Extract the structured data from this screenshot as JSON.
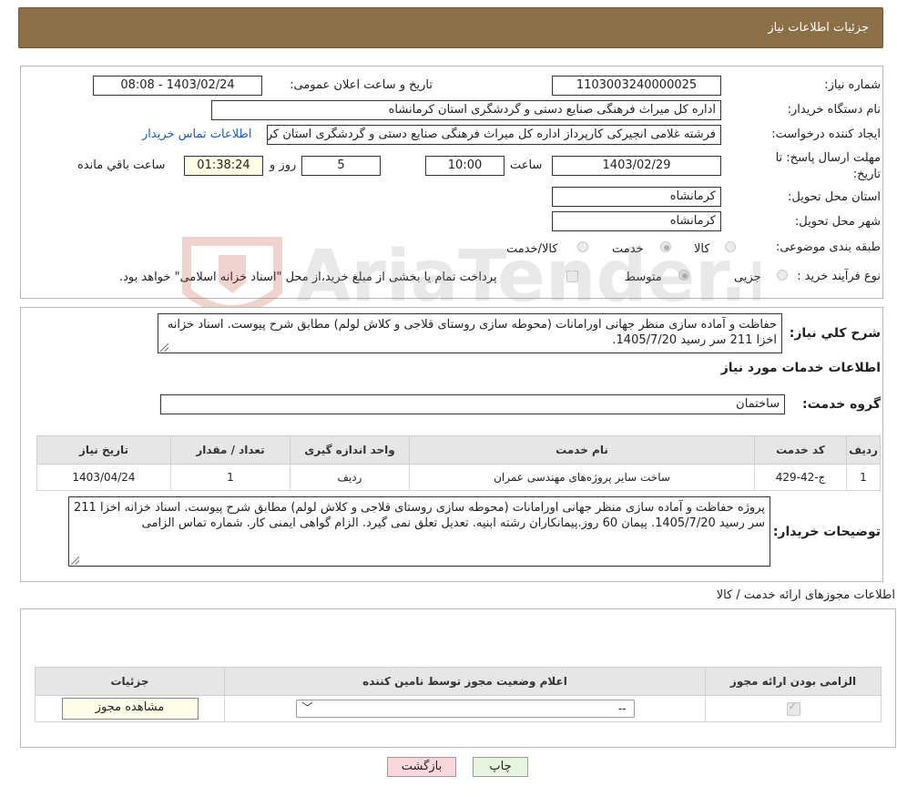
{
  "header": {
    "title": "جزئیات اطلاعات نیاز"
  },
  "form": {
    "need_number": {
      "label": "شماره نیاز:",
      "value": "1103003240000025"
    },
    "announce_datetime": {
      "label": "تاریخ و ساعت اعلان عمومی:",
      "value": "1403/02/24 - 08:08"
    },
    "buyer_org": {
      "label": "نام دستگاه خریدار:",
      "value": "اداره کل میراث فرهنگی  صنایع دستی و گردشگری استان کرمانشاه"
    },
    "requester": {
      "label": "ایجاد کننده درخواست:",
      "value": "فرشته غلامی انجیرکی کارپرداز اداره کل میراث فرهنگی  صنایع دستی و گردشگری استان کرمانشاه",
      "contact_link": "اطلاعات تماس خریدار"
    },
    "deadline": {
      "label_line1": "مهلت ارسال پاسخ: تا",
      "label_line2": "تاریخ:",
      "date": "1403/02/29",
      "time_label": "ساعت",
      "time": "10:00",
      "days": "5",
      "days_label": "روز و",
      "remaining": "01:38:24",
      "remaining_label": "ساعت باقي مانده"
    },
    "delivery_province": {
      "label": "استان محل تحویل:",
      "value": "کرمانشاه"
    },
    "delivery_city": {
      "label": "شهر محل تحویل:",
      "value": "کرمانشاه"
    },
    "category": {
      "label": "طبقه بندی موضوعی:",
      "options": [
        "کالا",
        "خدمت",
        "کالا/خدمت"
      ],
      "selected": "خدمت"
    },
    "purchase_type": {
      "label": "نوع فرآیند خرید :",
      "options": [
        "جزیی",
        "متوسط"
      ],
      "selected": "متوسط",
      "treasury_checkbox_label": "پرداخت تمام یا بخشی از مبلغ خرید،از محل \"اسناد خزانه اسلامی\" خواهد بود."
    }
  },
  "summary": {
    "label": "شرح کلي نياز:",
    "text": "حفاظت و آماده سازی منظر جهانی اورامانات (محوطه سازی روستای قلاجی و کلاش لولم) مطابق شرح پیوست. اسناد خزانه اخزا 211 سر رسید 1405/7/20."
  },
  "services_section": {
    "title": "اطلاعات خدمات مورد نیاز",
    "group_label": "گروه خدمت:",
    "group_value": "ساختمان",
    "table": {
      "headers": [
        "ردیف",
        "کد خدمت",
        "نام خدمت",
        "واحد اندازه گیری",
        "تعداد / مقدار",
        "تاریخ نیاز"
      ],
      "rows": [
        [
          "1",
          "ج-42-429",
          "ساخت سایر پروژه‌های مهندسی عمران",
          "ردیف",
          "1",
          "1403/04/24"
        ]
      ]
    },
    "buyer_notes_label": "توضیحات خریدار:",
    "buyer_notes": "پروژه حفاظت و آماده سازی منظر جهانی اورامانات (محوطه سازی روستای قلاجی و کلاش لولم) مطابق شرح پیوست. اسناد خزانه اخزا 211 سر رسید 1405/7/20. پیمان 60 روز.پیمانکاران رشته ابنیه. تعدیل تعلق نمی گیرد. الزام گواهی ایمنی کار. شماره تماس الزامی"
  },
  "permits_section": {
    "title": "اطلاعات مجوزهای ارائه خدمت / کالا",
    "table": {
      "headers": [
        "الزامی بودن ارائه مجوز",
        "اعلام وضعیت مجوز توسط نامین کننده",
        "جزئیات"
      ],
      "status_value": "--",
      "details_button": "مشاهده مجوز"
    }
  },
  "buttons": {
    "print": "چاپ",
    "back": "بازگشت"
  },
  "watermark": {
    "text": "AriaTender.neT"
  },
  "colors": {
    "header_bg": "#8b6f47",
    "link": "#1a5fa8",
    "back_btn_bg": "#f8d7dc",
    "print_btn_bg": "#e7f5df"
  }
}
